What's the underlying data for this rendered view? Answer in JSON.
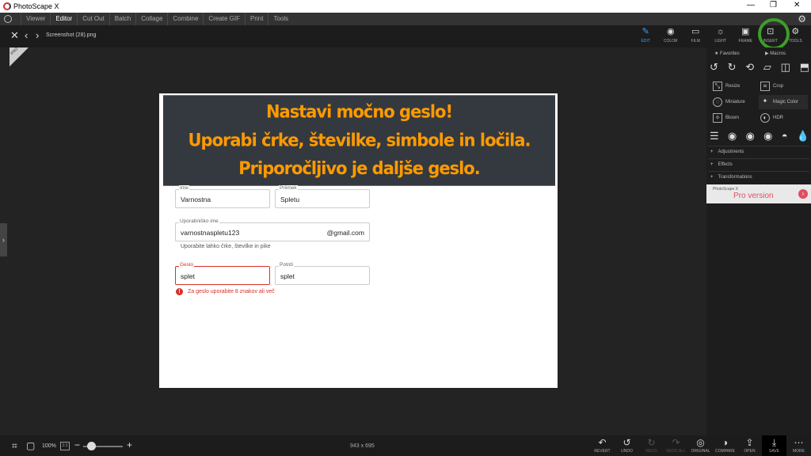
{
  "titlebar": {
    "title": "PhotoScape X",
    "min": "—",
    "restore": "❐",
    "close": "✕"
  },
  "menu": {
    "tabs": [
      "Viewer",
      "Editor",
      "Cut Out",
      "Batch",
      "Collage",
      "Combine",
      "Create GIF",
      "Print",
      "Tools"
    ],
    "active": "Editor"
  },
  "toolbar": {
    "filename": "Screenshot (28).png"
  },
  "modes": [
    {
      "label": "EDIT",
      "icon": "edit-icon",
      "glyph": "✎"
    },
    {
      "label": "COLOR",
      "icon": "color-icon",
      "glyph": "◉"
    },
    {
      "label": "FILM",
      "icon": "film-icon",
      "glyph": "▭"
    },
    {
      "label": "LIGHT",
      "icon": "light-icon",
      "glyph": "☼"
    },
    {
      "label": "FRAME",
      "icon": "frame-icon",
      "glyph": "▣"
    },
    {
      "label": "INSERT",
      "icon": "insert-icon",
      "glyph": "⊡"
    },
    {
      "label": "TOOLS",
      "icon": "tools-icon",
      "glyph": "⚙"
    }
  ],
  "canvas": {
    "banner": [
      "Nastavi močno geslo!",
      "Uporabi črke, številke, simbole in ločila.",
      "Priporočljivo je daljše geslo."
    ],
    "form": {
      "ime_label": "Ime",
      "ime_value": "Varnostna",
      "priimek_label": "Priimek",
      "priimek_value": "Spletu",
      "user_label": "Uporabniško ime",
      "user_value": "varnostnaspletu123",
      "user_suffix": "@gmail.com",
      "user_hint": "Uporabite lahko črke, številke in pike",
      "geslo_label": "Geslo",
      "geslo_value": "splet",
      "potrdi_label": "Potrdi",
      "potrdi_value": "splet",
      "error": "Za geslo uporabite 8 znakov ali več"
    }
  },
  "panel": {
    "favorites": "Favorites",
    "macros": "Macros",
    "rotate_icons": [
      "rotate-left-icon",
      "rotate-right-icon",
      "rotate-free-icon",
      "straighten-icon",
      "flip-horizontal-icon",
      "flip-vertical-icon"
    ],
    "tools": [
      {
        "label": "Resize",
        "icon": "resize-icon"
      },
      {
        "label": "Crop",
        "icon": "crop-icon"
      },
      {
        "label": "Miniature",
        "icon": "miniature-icon"
      },
      {
        "label": "Magic Color",
        "icon": "magic-color-icon"
      },
      {
        "label": "Bloom",
        "icon": "bloom-icon"
      },
      {
        "label": "HDR",
        "icon": "hdr-icon"
      }
    ],
    "sections": [
      "Adjustments",
      "Effects",
      "Transformations"
    ],
    "promo_small": "PhotoScape X",
    "promo_big": "Pro version"
  },
  "bottom": {
    "zoom": "100%",
    "one_to_one": "1:1",
    "dimensions": "943 x 695",
    "actions": [
      {
        "label": "REVERT",
        "icon": "revert-icon",
        "glyph": "↶",
        "dim": false
      },
      {
        "label": "UNDO",
        "icon": "undo-icon",
        "glyph": "↺",
        "dim": false
      },
      {
        "label": "REDO",
        "icon": "redo-icon",
        "glyph": "↻",
        "dim": true
      },
      {
        "label": "REDO ALL",
        "icon": "redo-all-icon",
        "glyph": "↷",
        "dim": true
      },
      {
        "label": "ORIGINAL",
        "icon": "original-icon",
        "glyph": "◎",
        "dim": false
      },
      {
        "label": "COMPARE",
        "icon": "compare-icon",
        "glyph": "◑",
        "dim": false
      },
      {
        "label": "OPEN",
        "icon": "open-icon",
        "glyph": "⇪",
        "dim": false
      },
      {
        "label": "SAVE",
        "icon": "save-icon",
        "glyph": "⤓",
        "dim": false
      },
      {
        "label": "MORE",
        "icon": "more-icon",
        "glyph": "⋯",
        "dim": false
      }
    ]
  },
  "colors": {
    "accent": "#3aa0ff",
    "highlight_ring": "#3e9d2a",
    "banner_bg": "#34393f",
    "banner_text": "#ff9a00",
    "error": "#d93025"
  }
}
